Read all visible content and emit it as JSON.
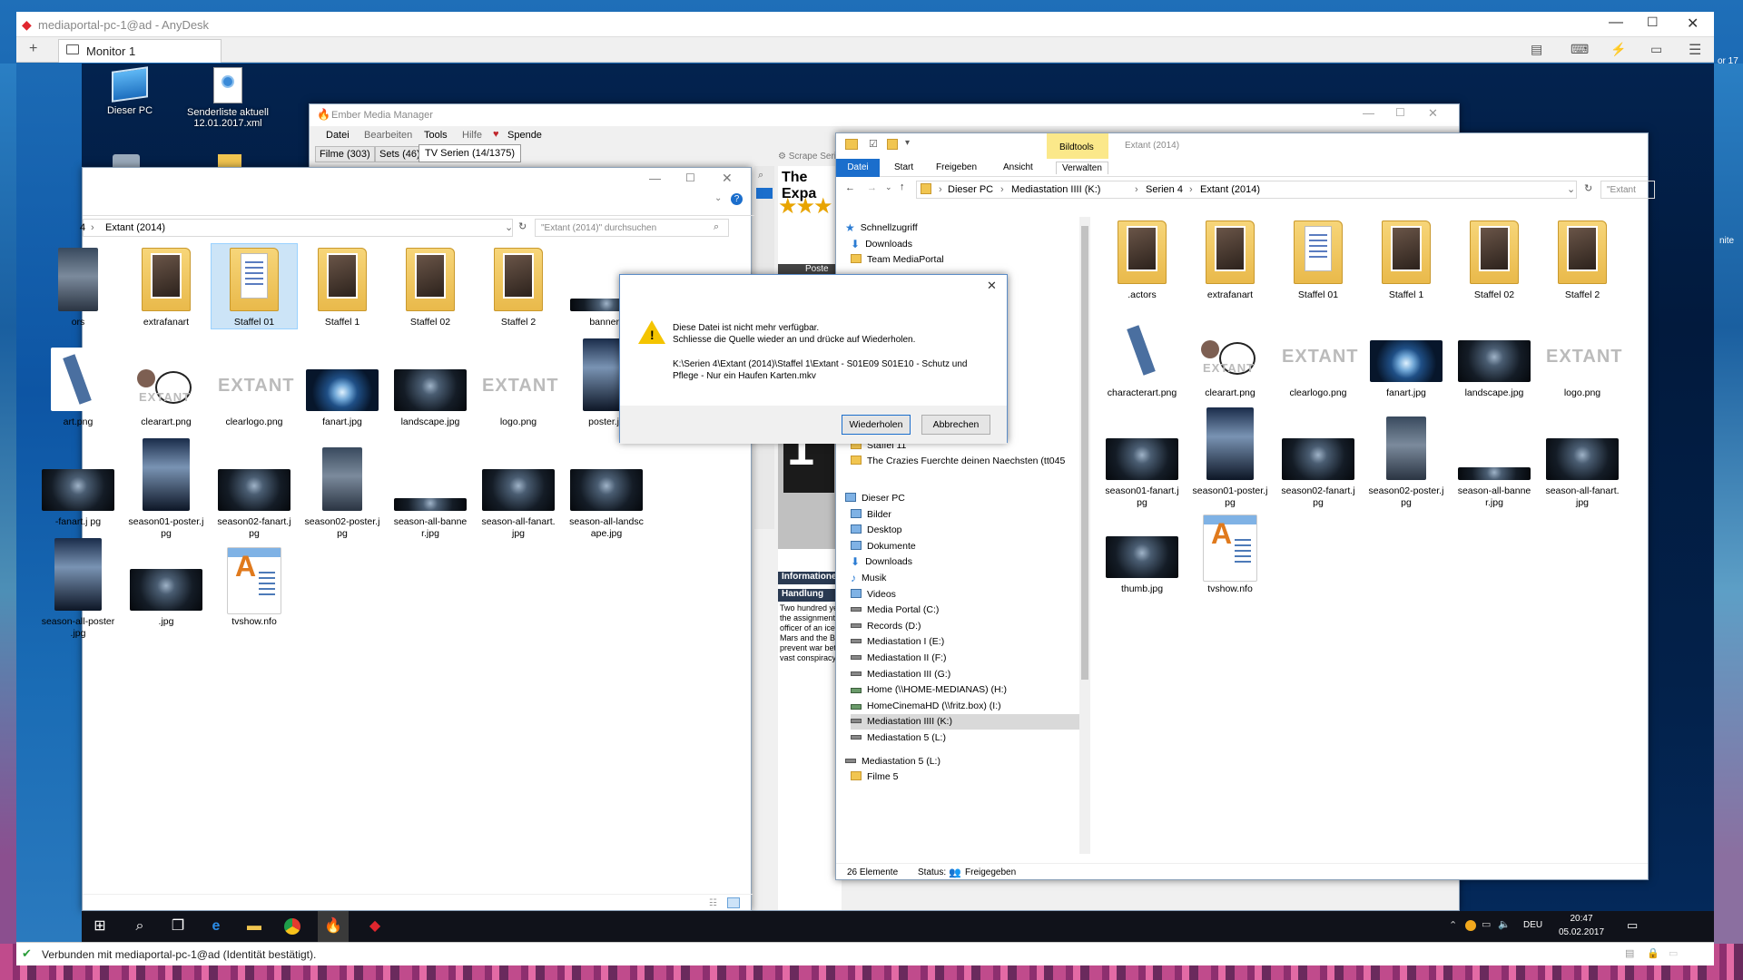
{
  "anydesk": {
    "title": "mediaportal-pc-1@ad - AnyDesk",
    "tab_add": "+",
    "tab_label": "Monitor 1",
    "status": "Verbunden mit mediaportal-pc-1@ad (Identität bestätigt).",
    "host_right_text_1": "or 17",
    "host_right_text_2": "nite"
  },
  "desktop": {
    "icons": [
      {
        "label": "Dieser PC"
      },
      {
        "label": "Senderliste aktuell 12.01.2017.xml"
      }
    ]
  },
  "ember": {
    "title": "Ember Media Manager",
    "menu": [
      "Datei",
      "Bearbeiten",
      "Tools",
      "Hilfe",
      "Spende"
    ],
    "tabs": [
      "Filme (303)",
      "Sets (46)",
      "TV Serien (14/1375)"
    ],
    "scrape": "Scrape Seri",
    "show_title": "The Expa",
    "poster_label": "Poste",
    "info_header": "Informatione",
    "plot_header": "Handlung",
    "plot_text": "Two hundred ye the assignment officer of an ice Mars and the B prevent war bet vast conspiracy"
  },
  "explorer_left": {
    "path_prefix": "4",
    "path": "Extant (2014)",
    "search_placeholder": "\"Extant (2014)\" durchsuchen",
    "items": [
      {
        "label": "ors",
        "kind": "face"
      },
      {
        "label": "extrafanart",
        "kind": "folder-pic"
      },
      {
        "label": "Staffel 01",
        "kind": "folder-doc"
      },
      {
        "label": "Staffel 1",
        "kind": "folder-pic"
      },
      {
        "label": "Staffel 02",
        "kind": "folder-pic"
      },
      {
        "label": "Staffel 2",
        "kind": "folder-pic"
      },
      {
        "label": "banner.j",
        "kind": "banner"
      },
      {
        "label": "art.png",
        "kind": "char"
      },
      {
        "label": "clearart.png",
        "kind": "clearart"
      },
      {
        "label": "clearlogo.png",
        "kind": "logo"
      },
      {
        "label": "fanart.jpg",
        "kind": "eye"
      },
      {
        "label": "landscape.jpg",
        "kind": "dark"
      },
      {
        "label": "logo.png",
        "kind": "logo"
      },
      {
        "label": "poster.jp",
        "kind": "poster"
      },
      {
        "label": "-fanart.j pg",
        "kind": "dark"
      },
      {
        "label": "season01-poster.j pg",
        "kind": "poster"
      },
      {
        "label": "season02-fanart.j pg",
        "kind": "dark"
      },
      {
        "label": "season02-poster.j pg",
        "kind": "face"
      },
      {
        "label": "season-all-banne r.jpg",
        "kind": "banner"
      },
      {
        "label": "season-all-fanart. jpg",
        "kind": "dark"
      },
      {
        "label": "season-all-landsc ape.jpg",
        "kind": "dark"
      },
      {
        "label": "season-all-poster .jpg",
        "kind": "poster"
      },
      {
        "label": ".jpg",
        "kind": "dark"
      },
      {
        "label": "tvshow.nfo",
        "kind": "nfo"
      }
    ]
  },
  "dialog": {
    "line1": "Diese Datei ist nicht mehr verfügbar.",
    "line2": "Schliesse die Quelle wieder an und drücke auf Wiederholen.",
    "path1": "K:\\Serien 4\\Extant (2014)\\Staffel 1\\Extant - S01E09 S01E10 - Schutz und",
    "path2": "Pflege - Nur ein Haufen Karten.mkv",
    "retry": "Wiederholen",
    "cancel": "Abbrechen",
    "close": "✕"
  },
  "explorer_right": {
    "ribbon_tool": "Bildtools",
    "ribbon_title": "Extant (2014)",
    "tabs": [
      "Datei",
      "Start",
      "Freigeben",
      "Ansicht",
      "Verwalten"
    ],
    "breadcrumb": [
      "Dieser PC",
      "Mediastation IIII (K:)",
      "Serien 4",
      "Extant (2014)"
    ],
    "search": "\"Extant",
    "nav_quick": [
      {
        "label": "Schnellzugriff",
        "icon": "star"
      },
      {
        "label": "Downloads",
        "icon": "download"
      },
      {
        "label": "Team MediaPortal",
        "icon": "folder"
      }
    ],
    "nav_mid": [
      {
        "label": "Media Portal (C:)",
        "icon": "drive"
      },
      {
        "label": "Staffel 11",
        "icon": "folder"
      },
      {
        "label": "The Crazies Fuerchte deinen Naechsten (tt045",
        "icon": "folder"
      }
    ],
    "nav_pc": [
      {
        "label": "Dieser PC",
        "icon": "pc"
      },
      {
        "label": "Bilder",
        "icon": "pc"
      },
      {
        "label": "Desktop",
        "icon": "pc"
      },
      {
        "label": "Dokumente",
        "icon": "pc"
      },
      {
        "label": "Downloads",
        "icon": "download"
      },
      {
        "label": "Musik",
        "icon": "music"
      },
      {
        "label": "Videos",
        "icon": "pc"
      },
      {
        "label": "Media Portal (C:)",
        "icon": "drive"
      },
      {
        "label": "Records (D:)",
        "icon": "drive"
      },
      {
        "label": "Mediastation I (E:)",
        "icon": "drive"
      },
      {
        "label": "Mediastation II (F:)",
        "icon": "drive"
      },
      {
        "label": "Mediastation III (G:)",
        "icon": "drive"
      },
      {
        "label": "Home (\\\\HOME-MEDIANAS) (H:)",
        "icon": "net"
      },
      {
        "label": "HomeCinemaHD (\\\\fritz.box) (I:)",
        "icon": "net"
      },
      {
        "label": "Mediastation IIII (K:)",
        "icon": "drive"
      },
      {
        "label": "Mediastation 5 (L:)",
        "icon": "drive"
      }
    ],
    "nav_bottom": [
      {
        "label": "Mediastation 5 (L:)",
        "icon": "drive"
      },
      {
        "label": "Filme 5",
        "icon": "folder"
      }
    ],
    "items": [
      {
        "label": ".actors",
        "kind": "folder-pic"
      },
      {
        "label": "extrafanart",
        "kind": "folder-pic"
      },
      {
        "label": "Staffel 01",
        "kind": "folder-doc"
      },
      {
        "label": "Staffel 1",
        "kind": "folder-pic"
      },
      {
        "label": "Staffel 02",
        "kind": "folder-pic"
      },
      {
        "label": "Staffel 2",
        "kind": "folder-pic"
      },
      {
        "label": "characterart.png",
        "kind": "char"
      },
      {
        "label": "clearart.png",
        "kind": "clearart"
      },
      {
        "label": "clearlogo.png",
        "kind": "logo"
      },
      {
        "label": "fanart.jpg",
        "kind": "eye"
      },
      {
        "label": "landscape.jpg",
        "kind": "dark"
      },
      {
        "label": "logo.png",
        "kind": "logo"
      },
      {
        "label": "season01-fanart.j pg",
        "kind": "dark"
      },
      {
        "label": "season01-poster.j pg",
        "kind": "poster"
      },
      {
        "label": "season02-fanart.j pg",
        "kind": "dark"
      },
      {
        "label": "season02-poster.j pg",
        "kind": "face"
      },
      {
        "label": "season-all-banne r.jpg",
        "kind": "banner"
      },
      {
        "label": "season-all-fanart. jpg",
        "kind": "dark"
      },
      {
        "label": "thumb.jpg",
        "kind": "dark"
      },
      {
        "label": "tvshow.nfo",
        "kind": "nfo"
      }
    ],
    "status_count": "26 Elemente",
    "status_label": "Status:",
    "status_value": "Freigegeben"
  },
  "taskbar": {
    "lang": "DEU",
    "time": "20:47",
    "date": "05.02.2017"
  }
}
